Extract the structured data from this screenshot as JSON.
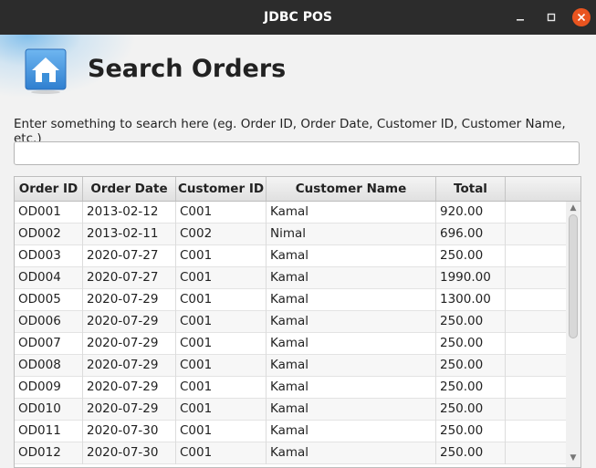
{
  "window": {
    "title": "JDBC POS"
  },
  "header": {
    "title": "Search Orders",
    "icon": "home-icon"
  },
  "search": {
    "hint": "Enter something to search here (eg. Order ID, Order Date, Customer ID, Customer Name, etc.)",
    "value": ""
  },
  "table": {
    "columns": [
      "Order ID",
      "Order Date",
      "Customer ID",
      "Customer Name",
      "Total",
      ""
    ],
    "rows": [
      [
        "OD001",
        "2013-02-12",
        "C001",
        "Kamal",
        "920.00"
      ],
      [
        "OD002",
        "2013-02-11",
        "C002",
        "Nimal",
        "696.00"
      ],
      [
        "OD003",
        "2020-07-27",
        "C001",
        "Kamal",
        "250.00"
      ],
      [
        "OD004",
        "2020-07-27",
        "C001",
        "Kamal",
        "1990.00"
      ],
      [
        "OD005",
        "2020-07-29",
        "C001",
        "Kamal",
        "1300.00"
      ],
      [
        "OD006",
        "2020-07-29",
        "C001",
        "Kamal",
        "250.00"
      ],
      [
        "OD007",
        "2020-07-29",
        "C001",
        "Kamal",
        "250.00"
      ],
      [
        "OD008",
        "2020-07-29",
        "C001",
        "Kamal",
        "250.00"
      ],
      [
        "OD009",
        "2020-07-29",
        "C001",
        "Kamal",
        "250.00"
      ],
      [
        "OD010",
        "2020-07-29",
        "C001",
        "Kamal",
        "250.00"
      ],
      [
        "OD011",
        "2020-07-30",
        "C001",
        "Kamal",
        "250.00"
      ],
      [
        "OD012",
        "2020-07-30",
        "C001",
        "Kamal",
        "250.00"
      ]
    ]
  },
  "colors": {
    "titlebar": "#2c2c2c",
    "close_button": "#e9541f",
    "icon_blue": "#3b8fd9"
  }
}
